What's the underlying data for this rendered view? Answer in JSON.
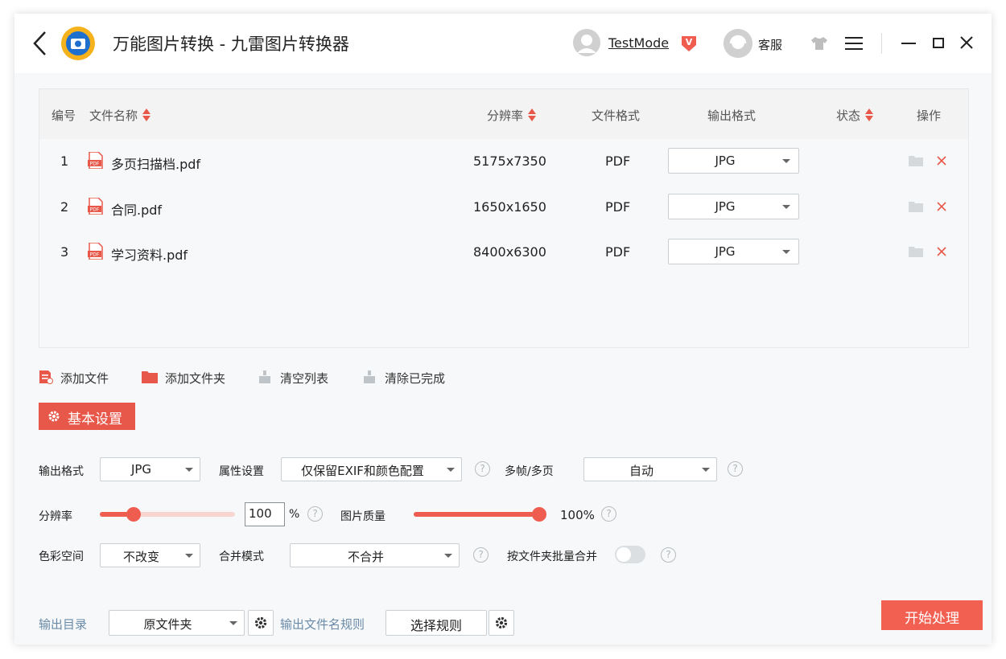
{
  "window": {
    "title": "万能图片转换 - 九雷图片转换器",
    "user_name": "TestMode",
    "vip_badge": "V",
    "service_label": "客服"
  },
  "table": {
    "headers": {
      "index": "编号",
      "name": "文件名称",
      "resolution": "分辨率",
      "format": "文件格式",
      "output": "输出格式",
      "status": "状态",
      "action": "操作"
    },
    "rows": [
      {
        "index": "1",
        "name": "多页扫描档.pdf",
        "resolution": "5175x7350",
        "format": "PDF",
        "output": "JPG",
        "status": ""
      },
      {
        "index": "2",
        "name": "合同.pdf",
        "resolution": "1650x1650",
        "format": "PDF",
        "output": "JPG",
        "status": ""
      },
      {
        "index": "3",
        "name": "学习资料.pdf",
        "resolution": "8400x6300",
        "format": "PDF",
        "output": "JPG",
        "status": ""
      }
    ]
  },
  "toolbar": {
    "add_file": "添加文件",
    "add_folder": "添加文件夹",
    "clear_list": "清空列表",
    "clear_done": "清除已完成"
  },
  "settings": {
    "tab_label": "基本设置",
    "output_format_label": "输出格式",
    "output_format_value": "JPG",
    "attr_label": "属性设置",
    "attr_value": "仅保留EXIF和颜色配置",
    "multiframe_label": "多帧/多页",
    "multiframe_value": "自动",
    "resolution_label": "分辨率",
    "resolution_value": "100",
    "resolution_percent": 0.22,
    "resolution_unit": "%",
    "quality_label": "图片质量",
    "quality_value": "100%",
    "quality_percent": 1.0,
    "colorspace_label": "色彩空间",
    "colorspace_value": "不改变",
    "merge_label": "合并模式",
    "merge_value": "不合并",
    "batch_merge_label": "按文件夹批量合并",
    "batch_merge_on": false,
    "help_glyph": "?"
  },
  "footer": {
    "output_dir_label": "输出目录",
    "output_dir_value": "原文件夹",
    "name_rule_label": "输出文件名规则",
    "name_rule_button": "选择规则",
    "start_button": "开始处理"
  },
  "colors": {
    "accent": "#e8584a",
    "start_button": "#f26052",
    "link_blue": "#6a8aa8"
  }
}
